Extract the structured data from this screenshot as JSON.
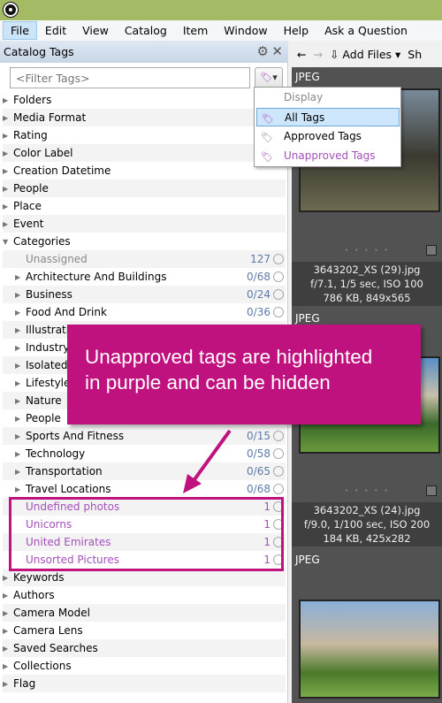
{
  "menu": [
    "File",
    "Edit",
    "View",
    "Catalog",
    "Item",
    "Window",
    "Help",
    "Ask a Question"
  ],
  "panel": {
    "title": "Catalog Tags",
    "filter_placeholder": "<Filter Tags>"
  },
  "tree": [
    {
      "label": "Folders",
      "tri": "▶"
    },
    {
      "label": "Media Format",
      "tri": "▶"
    },
    {
      "label": "Rating",
      "tri": "▶"
    },
    {
      "label": "Color Label",
      "tri": "▶"
    },
    {
      "label": "Creation Datetime",
      "tri": "▶"
    },
    {
      "label": "People",
      "tri": "▶"
    },
    {
      "label": "Place",
      "tri": "▶"
    },
    {
      "label": "Event",
      "tri": "▶"
    },
    {
      "label": "Categories",
      "tri": "▼"
    },
    {
      "label": "Unassigned",
      "count": "127",
      "indent": 1,
      "style": "grey"
    },
    {
      "label": "Architecture And Buildings",
      "count": "0/68",
      "indent": 1,
      "tri": "▶"
    },
    {
      "label": "Business",
      "count": "0/24",
      "indent": 1,
      "tri": "▶"
    },
    {
      "label": "Food And Drink",
      "count": "0/36",
      "indent": 1,
      "tri": "▶"
    },
    {
      "label": "Illustrations",
      "indent": 1,
      "tri": "▶"
    },
    {
      "label": "Industry",
      "indent": 1,
      "tri": "▶"
    },
    {
      "label": "Isolated",
      "indent": 1,
      "tri": "▶"
    },
    {
      "label": "Lifestyle",
      "indent": 1,
      "tri": "▶"
    },
    {
      "label": "Nature",
      "indent": 1,
      "tri": "▶"
    },
    {
      "label": "People",
      "indent": 1,
      "tri": "▶"
    },
    {
      "label": "Sports And Fitness",
      "count": "0/15",
      "indent": 1,
      "tri": "▶"
    },
    {
      "label": "Technology",
      "count": "0/58",
      "indent": 1,
      "tri": "▶"
    },
    {
      "label": "Transportation",
      "count": "0/65",
      "indent": 1,
      "tri": "▶"
    },
    {
      "label": "Travel Locations",
      "count": "0/68",
      "indent": 1,
      "tri": "▶"
    },
    {
      "label": "Undefined photos",
      "count": "1",
      "indent": 1,
      "style": "purple"
    },
    {
      "label": "Unicorns",
      "count": "1",
      "indent": 1,
      "style": "purple"
    },
    {
      "label": "United Emirates",
      "count": "1",
      "indent": 1,
      "style": "purple"
    },
    {
      "label": "Unsorted Pictures",
      "count": "1",
      "indent": 1,
      "style": "purple"
    },
    {
      "label": "Keywords",
      "tri": "▶"
    },
    {
      "label": "Authors",
      "tri": "▶"
    },
    {
      "label": "Camera Model",
      "tri": "▶"
    },
    {
      "label": "Camera Lens",
      "tri": "▶"
    },
    {
      "label": "Saved Searches",
      "tri": "▶"
    },
    {
      "label": "Collections",
      "tri": "▶"
    },
    {
      "label": "Flag",
      "tri": "▶"
    }
  ],
  "dropdown": {
    "header": "Display",
    "items": [
      "All Tags",
      "Approved Tags",
      "Unapproved Tags"
    ],
    "selected": "All Tags"
  },
  "toolbar": {
    "add_files": "Add Files",
    "more": "Sh"
  },
  "thumbs": [
    {
      "type": "JPEG",
      "name": "3643202_XS (29).jpg",
      "exif": "f/7.1, 1/5 sec, ISO 100",
      "size": "786 KB, 849x565"
    },
    {
      "type": "JPEG",
      "name": "3643202_XS (24).jpg",
      "exif": "f/9.0, 1/100 sec, ISO 200",
      "size": "184 KB, 425x282"
    },
    {
      "type": "JPEG"
    }
  ],
  "callout": {
    "line1": "Unapproved tags are highlighted",
    "line2": "in purple and can be hidden"
  },
  "colors": {
    "titlebar": "#a4ba64",
    "callout": "#c0127f",
    "unapproved": "#a34fb8"
  }
}
